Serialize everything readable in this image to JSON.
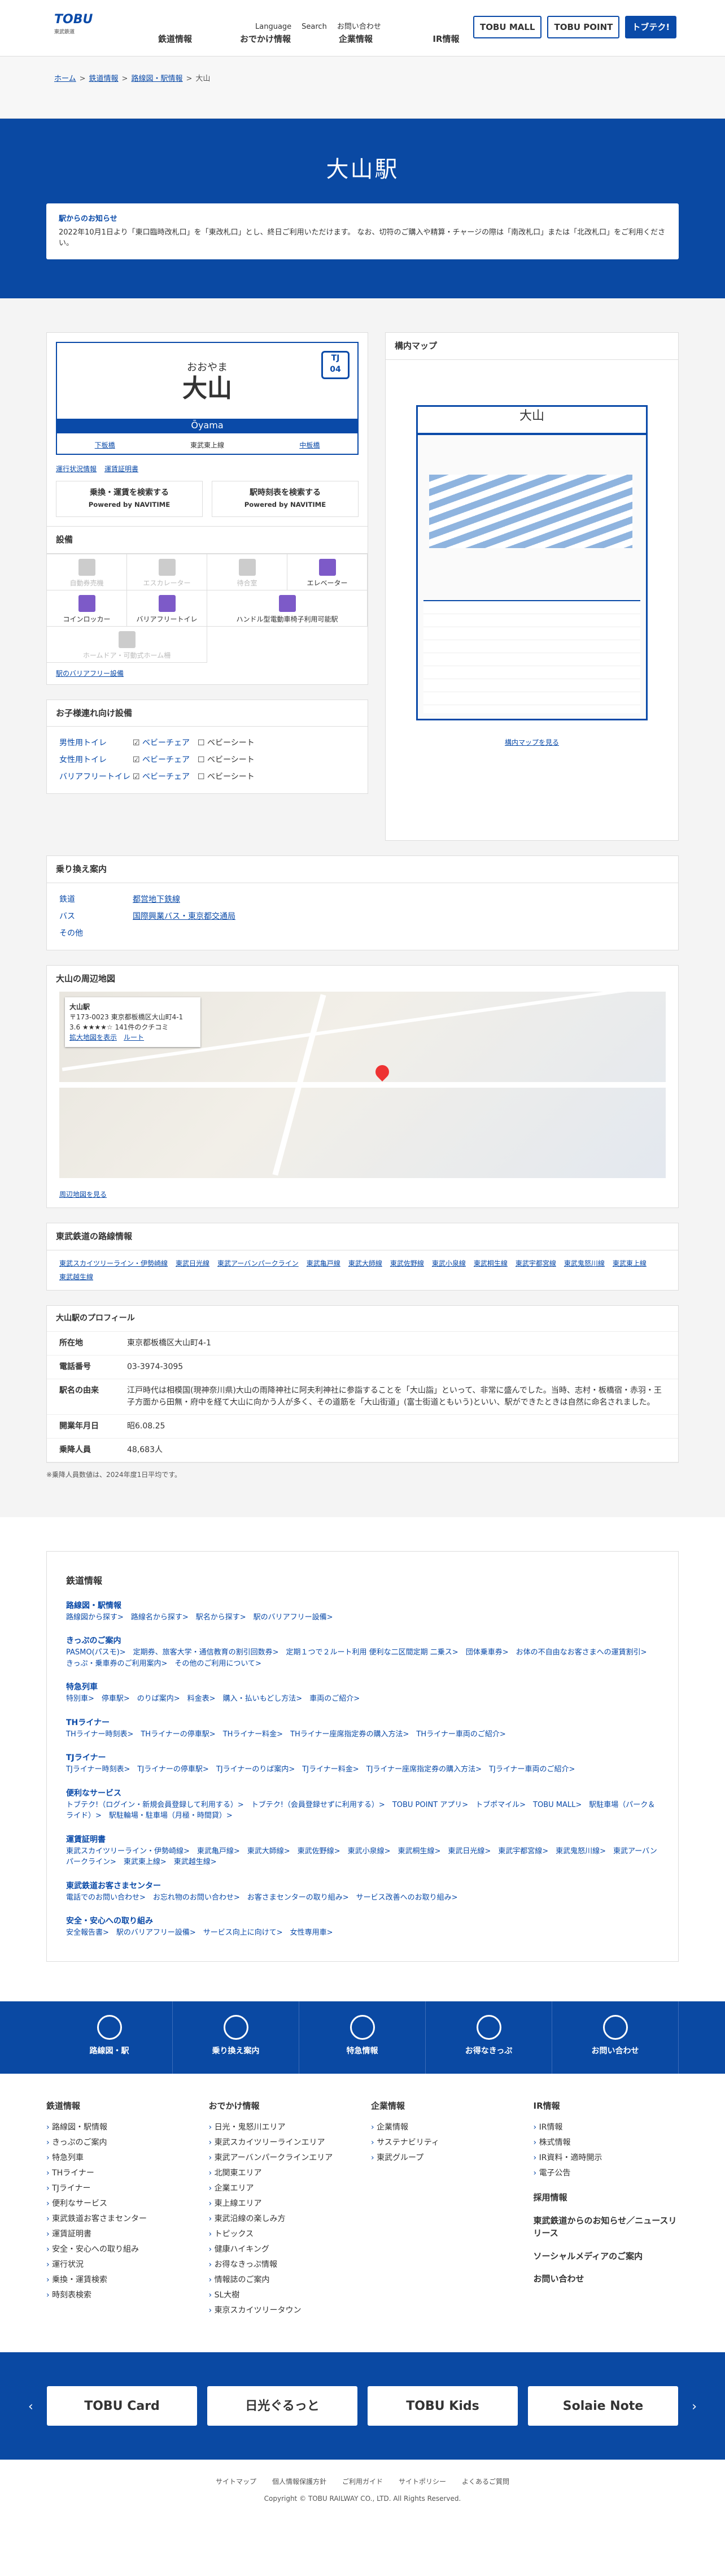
{
  "header": {
    "logo": "TOBU",
    "logo_sub": "東武鉄道",
    "nav": [
      "鉄道情報",
      "おでかけ情報",
      "企業情報",
      "IR情報"
    ],
    "util": [
      "Language",
      "Search",
      "お問い合わせ"
    ],
    "btns": [
      "TOBU MALL",
      "TOBU POINT",
      "トブテク!"
    ]
  },
  "breadcrumb": [
    "ホーム",
    "鉄道情報",
    "路線図・駅情報",
    "大山"
  ],
  "hero": {
    "title": "大山駅",
    "notice_title": "駅からのお知らせ",
    "notice_text": "2022年10月1日より「東口臨時改札口」を「東改札口」とし、終日ご利用いただけます。 なお、切符のご購入や精算・チャージの際は「南改札口」または「北改札口」をご利用ください。"
  },
  "station": {
    "kana": "おおやま",
    "kanji": "大山",
    "num_line": "TJ",
    "num": "04",
    "roman": "Ōyama",
    "prev": "下板橋",
    "mid": "東武東上線",
    "next": "中板橋",
    "links": [
      "運行状況情報",
      "運賃証明書"
    ],
    "search": [
      "乗換・運賃を検索する",
      "駅時刻表を検索する"
    ],
    "powered": "Powered by NAVITIME"
  },
  "facilities": {
    "title": "設備",
    "items": [
      "自動券売機",
      "エスカレーター",
      "待合室",
      "エレベーター",
      "コインロッカー",
      "バリアフリートイレ",
      "ハンドル型電動車椅子利用可能駅",
      "ホームドア・可動式ホーム柵"
    ],
    "on": [
      false,
      false,
      false,
      true,
      true,
      true,
      true,
      false
    ],
    "link": "駅のバリアフリー設備"
  },
  "kids": {
    "title": "お子様連れ向け設備",
    "rows": [
      {
        "k": "男性用トイレ",
        "a": "ベビーチェア",
        "b": "ベビーシート"
      },
      {
        "k": "女性用トイレ",
        "a": "ベビーチェア",
        "b": "ベビーシート"
      },
      {
        "k": "バリアフリートイレ",
        "a": "ベビーチェア",
        "b": "ベビーシート"
      }
    ]
  },
  "map": {
    "title": "構内マップ",
    "name": "大山",
    "link": "構内マップを見る"
  },
  "transfer": {
    "title": "乗り換え案内",
    "rows": [
      {
        "k": "鉄道",
        "v": "都営地下鉄線"
      },
      {
        "k": "バス",
        "v": "国際興業バス・東京都交通局"
      },
      {
        "k": "その他",
        "v": ""
      }
    ]
  },
  "area": {
    "title": "大山の周辺地図",
    "place": "大山駅",
    "addr": "〒173-0023 東京都板橋区大山町4-1",
    "rating": "3.6 ★★★★☆ 141件のクチコミ",
    "bigger": "拡大地図を表示",
    "route": "ルート",
    "link": "周辺地図を見る"
  },
  "routes": {
    "title": "東武鉄道の路線情報",
    "items": [
      "東武スカイツリーライン・伊勢崎線",
      "東武日光線",
      "東武アーバンパークライン",
      "東武亀戸線",
      "東武大師線",
      "東武佐野線",
      "東武小泉線",
      "東武桐生線",
      "東武宇都宮線",
      "東武鬼怒川線",
      "東武東上線",
      "東武越生線"
    ]
  },
  "profile": {
    "title": "大山駅のプロフィール",
    "rows": [
      {
        "k": "所在地",
        "v": "東京都板橋区大山町4-1"
      },
      {
        "k": "電話番号",
        "v": "03-3974-3095"
      },
      {
        "k": "駅名の由来",
        "v": "江戸時代は相模国(現神奈川県)大山の雨降神社に阿夫利神社に参詣することを「大山詣」といって、非常に盛んでした。当時、志村・板橋宿・赤羽・王子方面から田無・府中を経て大山に向かう人が多く、その道筋を「大山街道」(富士街道ともいう)といい、駅ができたときは自然に命名されました。"
      },
      {
        "k": "開業年月日",
        "v": "昭6.08.25"
      },
      {
        "k": "乗降人員",
        "v": "48,683人"
      }
    ],
    "note": "※乗降人員数値は、2024年度1日平均です。"
  },
  "links": {
    "title": "鉄道情報",
    "groups": [
      {
        "h": "路線図・駅情報",
        "t": "路線図から探す>　路線名から探す>　駅名から探す>　駅のバリアフリー設備>"
      },
      {
        "h": "きっぷのご案内",
        "t": "PASMO(パスモ)>　定期券、旅客大学・通信教育の割引回数券>　定期１つで２ルート利用 便利な二区間定期 二乗ス>　団体乗車券>　お体の不自由なお客さまへの運賃割引>　きっぷ・乗車券のご利用案内>　その他のご利用について>"
      },
      {
        "h": "特急列車",
        "t": "特別車>　停車駅>　のりば案内>　料金表>　購入・払いもどし方法>　車両のご紹介>"
      },
      {
        "h": "THライナー",
        "t": "THライナー時刻表>　THライナーの停車駅>　THライナー料金>　THライナー座席指定券の購入方法>　THライナー車両のご紹介>"
      },
      {
        "h": "TJライナー",
        "t": "TJライナー時刻表>　TJライナーの停車駅>　TJライナーのりば案内>　TJライナー料金>　TJライナー座席指定券の購入方法>　TJライナー車両のご紹介>"
      },
      {
        "h": "便利なサービス",
        "t": "トブテク!（ログイン・新規会員登録して利用する）>　トブテク!（会員登録せずに利用する）>　TOBU POINT アプリ>　トブポマイル>　TOBU MALL>　駅駐車場（パーク＆ライド）>　駅駐輪場・駐車場（月極・時間貸）>"
      },
      {
        "h": "運賃証明書",
        "t": "東武スカイツリーライン・伊勢崎線>　東武亀戸線>　東武大師線>　東武佐野線>　東武小泉線>　東武桐生線>　東武日光線>　東武宇都宮線>　東武鬼怒川線>　東武アーバンパークライン>　東武東上線>　東武越生線>"
      },
      {
        "h": "東武鉄道お客さまセンター",
        "t": "電話でのお問い合わせ>　お忘れ物のお問い合わせ>　お客さまセンターの取り組み>　サービス改善へのお取り組み>"
      },
      {
        "h": "安全・安心への取り組み",
        "t": "安全報告書>　駅のバリアフリー設備>　サービス向上に向けて>　女性専用車>"
      }
    ]
  },
  "bluebar": [
    "路線図・駅",
    "乗り換え案内",
    "特急情報",
    "お得なきっぷ",
    "お問い合わせ"
  ],
  "footer": [
    {
      "h": "鉄道情報",
      "i": [
        "路線図・駅情報",
        "きっぷのご案内",
        "特急列車",
        "THライナー",
        "TJライナー",
        "便利なサービス",
        "東武鉄道お客さまセンター",
        "運賃証明書",
        "安全・安心への取り組み",
        "運行状況",
        "乗換・運賃検索",
        "時刻表検索"
      ]
    },
    {
      "h": "おでかけ情報",
      "i": [
        "日光・鬼怒川エリア",
        "東武スカイツリーラインエリア",
        "東武アーバンパークラインエリア",
        "北関東エリア",
        "企業エリア",
        "東上線エリア",
        "東武沿線の楽しみ方",
        "トピックス",
        "健康ハイキング",
        "お得なきっぷ情報",
        "情報誌のご案内",
        "SL大樹",
        "東京スカイツリータウン"
      ]
    },
    {
      "h": "企業情報",
      "i": [
        "企業情報",
        "サステナビリティ",
        "東武グループ"
      ]
    },
    {
      "h": "IR情報",
      "i": [
        "IR情報",
        "株式情報",
        "IR資料・適時開示",
        "電子公告"
      ],
      "extra": [
        "採用情報",
        "東武鉄道からのお知らせ／ニュースリリース",
        "ソーシャルメディアのご案内",
        "お問い合わせ"
      ]
    }
  ],
  "banners": [
    "TOBU Card",
    "日光ぐるっと",
    "TOBU Kids",
    "Solaie Note"
  ],
  "bottom": {
    "links": [
      "サイトマップ",
      "個人情報保護方針",
      "ご利用ガイド",
      "サイトポリシー",
      "よくあるご質問"
    ],
    "copy": "Copyright © TOBU RAILWAY CO., LTD. All Rights Reserved."
  }
}
